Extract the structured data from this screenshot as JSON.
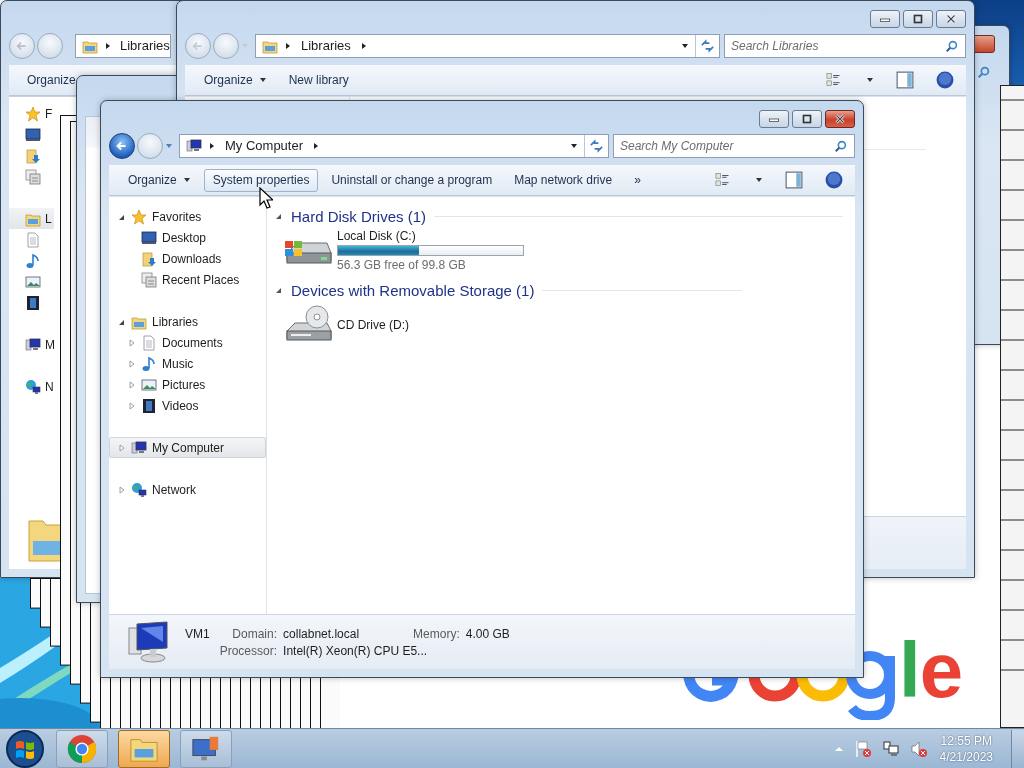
{
  "back_window": {
    "address": "Libraries",
    "toolbar": [
      {
        "label": "Organize"
      }
    ],
    "sidebar": [
      {
        "kind": "star",
        "label": "F",
        "selected": false
      },
      {
        "kind": "desktop",
        "selected": false
      },
      {
        "kind": "downloads",
        "selected": false
      },
      {
        "kind": "recent",
        "selected": false
      },
      {
        "kind": "libraries",
        "label": "L",
        "selected": true
      },
      {
        "kind": "documents",
        "selected": false
      },
      {
        "kind": "music",
        "selected": false
      },
      {
        "kind": "pictures",
        "selected": false
      },
      {
        "kind": "videos",
        "selected": false
      },
      {
        "kind": "computer",
        "label": "M",
        "selected": false
      },
      {
        "kind": "network",
        "label": "N",
        "selected": false
      }
    ]
  },
  "libraries_window": {
    "active": false,
    "back_enabled": false,
    "address": "Libraries",
    "search_placeholder": "Search Libraries",
    "toolbar": [
      {
        "label": "Organize",
        "dropdown": true,
        "hovered": false
      },
      {
        "label": "New library",
        "dropdown": false,
        "hovered": false
      }
    ]
  },
  "main_window": {
    "active": true,
    "back_enabled": true,
    "address": "My Computer",
    "search_placeholder": "Search My Computer",
    "toolbar": [
      {
        "label": "Organize",
        "dropdown": true,
        "hovered": false
      },
      {
        "label": "System properties",
        "dropdown": false,
        "hovered": true
      },
      {
        "label": "Uninstall or change a program",
        "dropdown": false,
        "hovered": false
      },
      {
        "label": "Map network drive",
        "dropdown": false,
        "hovered": false
      }
    ],
    "toolbar_more": "»",
    "nav_tree": [
      {
        "label": "Favorites",
        "kind": "star",
        "expanded": true,
        "selected": false,
        "children": [
          {
            "label": "Desktop",
            "kind": "desktop",
            "selected": false
          },
          {
            "label": "Downloads",
            "kind": "downloads",
            "selected": false
          },
          {
            "label": "Recent Places",
            "kind": "recent",
            "selected": false
          }
        ]
      },
      {
        "label": "Libraries",
        "kind": "libraries",
        "expanded": true,
        "selected": false,
        "children": [
          {
            "label": "Documents",
            "kind": "documents",
            "expanded": false,
            "selected": false
          },
          {
            "label": "Music",
            "kind": "music",
            "expanded": false,
            "selected": false
          },
          {
            "label": "Pictures",
            "kind": "pictures",
            "expanded": false,
            "selected": false
          },
          {
            "label": "Videos",
            "kind": "videos",
            "expanded": false,
            "selected": false
          }
        ]
      },
      {
        "label": "My Computer",
        "kind": "computer",
        "expanded": false,
        "selected": true
      },
      {
        "label": "Network",
        "kind": "network",
        "expanded": false,
        "selected": false
      }
    ],
    "groups": [
      {
        "title": "Hard Disk Drives (1)",
        "items": [
          {
            "kind": "disk",
            "name": "Local Disk (C:)",
            "level": 0.44,
            "free_text": "56.3 GB free of 99.8 GB"
          }
        ]
      },
      {
        "title": "Devices with Removable Storage (1)",
        "items": [
          {
            "kind": "cd",
            "name": "CD Drive (D:)"
          }
        ]
      }
    ],
    "details": {
      "name": "VM1",
      "domain_label": "Domain:",
      "domain": "collabnet.local",
      "memory_label": "Memory:",
      "memory": "4.00 GB",
      "processor_label": "Processor:",
      "processor": "Intel(R) Xeon(R) CPU E5..."
    }
  },
  "browser_logo": [
    {
      "text": "l",
      "color": "#34a853"
    },
    {
      "text": "e",
      "color": "#ea4335"
    }
  ],
  "taskbar": {
    "apps": [
      {
        "kind": "chrome",
        "selected": false
      },
      {
        "kind": "explorer",
        "selected": true
      },
      {
        "kind": "remote",
        "selected": false
      }
    ],
    "time": "12:55 PM",
    "date": "4/21/2023"
  }
}
